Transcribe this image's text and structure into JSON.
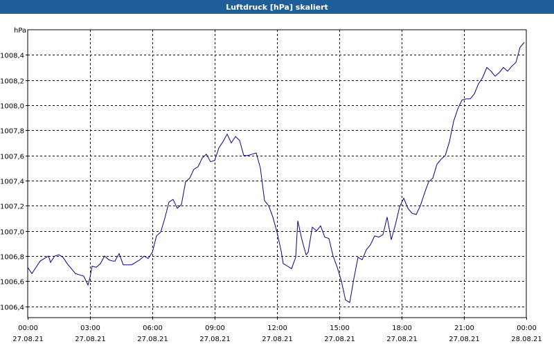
{
  "window": {
    "title": "Luftdruck [hPa] skaliert"
  },
  "colors": {
    "titlebar": "#1f5f99",
    "line": "#00008b",
    "grid": "#000000"
  },
  "chart_data": {
    "type": "line",
    "title": "Luftdruck [hPa] skaliert",
    "ylabel": "hPa",
    "xlabel": "",
    "grid": true,
    "ylim": [
      1006.31,
      1008.6
    ],
    "xlim": [
      0,
      24
    ],
    "y_ticks": [
      "1006,4",
      "1006,6",
      "1006,8",
      "1007,0",
      "1007,2",
      "1007,4",
      "1007,6",
      "1007,8",
      "1008,0",
      "1008,2",
      "1008,4"
    ],
    "y_tick_values": [
      1006.4,
      1006.6,
      1006.8,
      1007.0,
      1007.2,
      1007.4,
      1007.6,
      1007.8,
      1008.0,
      1008.2,
      1008.4
    ],
    "x_ticks": [
      {
        "time": "00:00",
        "date": "27.08.21"
      },
      {
        "time": "03:00",
        "date": "27.08.21"
      },
      {
        "time": "06:00",
        "date": "27.08.21"
      },
      {
        "time": "09:00",
        "date": "27.08.21"
      },
      {
        "time": "12:00",
        "date": "27.08.21"
      },
      {
        "time": "15:00",
        "date": "27.08.21"
      },
      {
        "time": "18:00",
        "date": "27.08.21"
      },
      {
        "time": "21:00",
        "date": "27.08.21"
      },
      {
        "time": "00:00",
        "date": "28.08.21"
      }
    ],
    "x_tick_values": [
      0,
      3,
      6,
      9,
      12,
      15,
      18,
      21,
      24
    ],
    "series": [
      {
        "x": [
          0,
          0.2,
          0.4,
          0.6,
          0.8,
          1.0,
          1.1,
          1.3,
          1.5,
          1.7,
          1.9,
          2.1,
          2.3,
          2.5,
          2.7,
          2.9,
          3.0,
          3.1,
          3.3,
          3.5,
          3.7,
          3.9,
          4.1,
          4.2,
          4.4,
          4.6,
          4.8,
          5.0,
          5.2,
          5.4,
          5.6,
          5.8,
          6.0,
          6.2,
          6.4,
          6.6,
          6.8,
          7.0,
          7.2,
          7.4,
          7.6,
          7.8,
          8.0,
          8.2,
          8.4,
          8.6,
          8.8,
          9.0,
          9.2,
          9.4,
          9.6,
          9.8,
          10.0,
          10.2,
          10.4,
          10.6,
          10.8,
          11.0,
          11.2,
          11.4,
          11.6,
          11.8,
          12.0,
          12.2,
          12.3,
          12.5,
          12.7,
          12.9,
          13.0,
          13.2,
          13.4,
          13.5,
          13.7,
          13.9,
          14.1,
          14.3,
          14.5,
          14.7,
          14.9,
          15.1,
          15.3,
          15.5,
          15.7,
          15.9,
          16.1,
          16.3,
          16.5,
          16.7,
          16.9,
          17.1,
          17.3,
          17.5,
          17.7,
          17.9,
          18.1,
          18.3,
          18.5,
          18.7,
          18.9,
          19.1,
          19.3,
          19.5,
          19.7,
          19.9,
          20.1,
          20.3,
          20.5,
          20.7,
          20.9,
          21.1,
          21.3,
          21.5,
          21.7,
          21.9,
          22.1,
          22.3,
          22.5,
          22.7,
          22.9,
          23.1,
          23.3,
          23.5,
          23.7,
          23.9
        ],
        "y": [
          1006.71,
          1006.66,
          1006.71,
          1006.76,
          1006.78,
          1006.8,
          1006.75,
          1006.8,
          1006.81,
          1006.79,
          1006.74,
          1006.7,
          1006.66,
          1006.65,
          1006.64,
          1006.57,
          1006.63,
          1006.72,
          1006.71,
          1006.74,
          1006.8,
          1006.77,
          1006.76,
          1006.76,
          1006.82,
          1006.73,
          1006.73,
          1006.73,
          1006.75,
          1006.77,
          1006.8,
          1006.78,
          1006.83,
          1006.96,
          1006.99,
          1007.1,
          1007.23,
          1007.25,
          1007.18,
          1007.21,
          1007.39,
          1007.42,
          1007.49,
          1007.51,
          1007.58,
          1007.61,
          1007.55,
          1007.56,
          1007.66,
          1007.71,
          1007.77,
          1007.7,
          1007.75,
          1007.72,
          1007.6,
          1007.6,
          1007.61,
          1007.62,
          1007.5,
          1007.24,
          1007.2,
          1007.11,
          1006.99,
          1006.84,
          1006.74,
          1006.72,
          1006.7,
          1006.79,
          1007.08,
          1006.93,
          1006.81,
          1006.83,
          1007.03,
          1007.0,
          1007.04,
          1006.95,
          1006.94,
          1006.8,
          1006.71,
          1006.6,
          1006.45,
          1006.43,
          1006.62,
          1006.79,
          1006.77,
          1006.85,
          1006.89,
          1006.96,
          1006.95,
          1006.97,
          1007.11,
          1006.93,
          1007.05,
          1007.19,
          1007.26,
          1007.18,
          1007.14,
          1007.13,
          1007.2,
          1007.3,
          1007.39,
          1007.42,
          1007.53,
          1007.57,
          1007.6,
          1007.71,
          1007.87,
          1007.97,
          1008.04,
          1008.05,
          1008.05,
          1008.09,
          1008.17,
          1008.22,
          1008.3,
          1008.27,
          1008.23,
          1008.26,
          1008.3,
          1008.27,
          1008.31,
          1008.34,
          1008.46,
          1008.5
        ]
      }
    ]
  }
}
